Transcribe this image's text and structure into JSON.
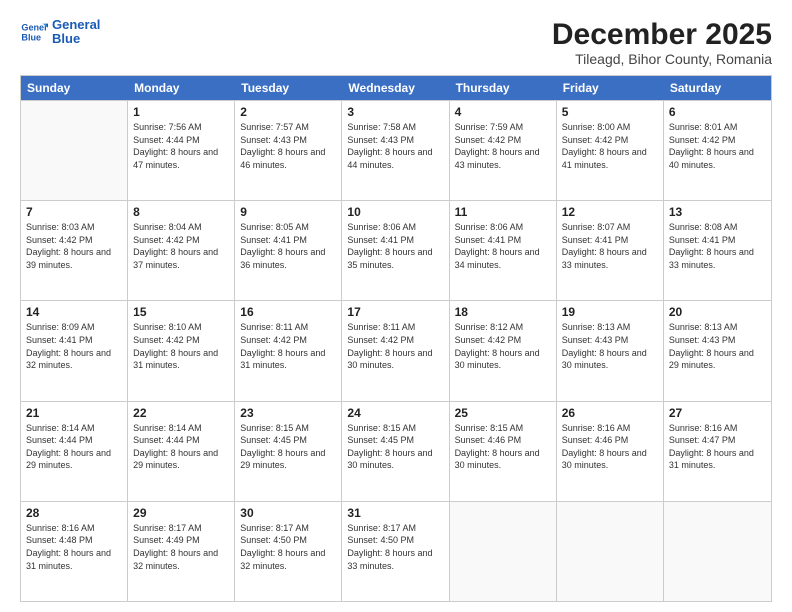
{
  "logo": {
    "line1": "General",
    "line2": "Blue"
  },
  "title": "December 2025",
  "subtitle": "Tileagd, Bihor County, Romania",
  "header_days": [
    "Sunday",
    "Monday",
    "Tuesday",
    "Wednesday",
    "Thursday",
    "Friday",
    "Saturday"
  ],
  "weeks": [
    [
      {
        "day": "",
        "empty": true
      },
      {
        "day": "1",
        "sunrise": "7:56 AM",
        "sunset": "4:44 PM",
        "daylight": "8 hours and 47 minutes."
      },
      {
        "day": "2",
        "sunrise": "7:57 AM",
        "sunset": "4:43 PM",
        "daylight": "8 hours and 46 minutes."
      },
      {
        "day": "3",
        "sunrise": "7:58 AM",
        "sunset": "4:43 PM",
        "daylight": "8 hours and 44 minutes."
      },
      {
        "day": "4",
        "sunrise": "7:59 AM",
        "sunset": "4:42 PM",
        "daylight": "8 hours and 43 minutes."
      },
      {
        "day": "5",
        "sunrise": "8:00 AM",
        "sunset": "4:42 PM",
        "daylight": "8 hours and 41 minutes."
      },
      {
        "day": "6",
        "sunrise": "8:01 AM",
        "sunset": "4:42 PM",
        "daylight": "8 hours and 40 minutes."
      }
    ],
    [
      {
        "day": "7",
        "sunrise": "8:03 AM",
        "sunset": "4:42 PM",
        "daylight": "8 hours and 39 minutes."
      },
      {
        "day": "8",
        "sunrise": "8:04 AM",
        "sunset": "4:42 PM",
        "daylight": "8 hours and 37 minutes."
      },
      {
        "day": "9",
        "sunrise": "8:05 AM",
        "sunset": "4:41 PM",
        "daylight": "8 hours and 36 minutes."
      },
      {
        "day": "10",
        "sunrise": "8:06 AM",
        "sunset": "4:41 PM",
        "daylight": "8 hours and 35 minutes."
      },
      {
        "day": "11",
        "sunrise": "8:06 AM",
        "sunset": "4:41 PM",
        "daylight": "8 hours and 34 minutes."
      },
      {
        "day": "12",
        "sunrise": "8:07 AM",
        "sunset": "4:41 PM",
        "daylight": "8 hours and 33 minutes."
      },
      {
        "day": "13",
        "sunrise": "8:08 AM",
        "sunset": "4:41 PM",
        "daylight": "8 hours and 33 minutes."
      }
    ],
    [
      {
        "day": "14",
        "sunrise": "8:09 AM",
        "sunset": "4:41 PM",
        "daylight": "8 hours and 32 minutes."
      },
      {
        "day": "15",
        "sunrise": "8:10 AM",
        "sunset": "4:42 PM",
        "daylight": "8 hours and 31 minutes."
      },
      {
        "day": "16",
        "sunrise": "8:11 AM",
        "sunset": "4:42 PM",
        "daylight": "8 hours and 31 minutes."
      },
      {
        "day": "17",
        "sunrise": "8:11 AM",
        "sunset": "4:42 PM",
        "daylight": "8 hours and 30 minutes."
      },
      {
        "day": "18",
        "sunrise": "8:12 AM",
        "sunset": "4:42 PM",
        "daylight": "8 hours and 30 minutes."
      },
      {
        "day": "19",
        "sunrise": "8:13 AM",
        "sunset": "4:43 PM",
        "daylight": "8 hours and 30 minutes."
      },
      {
        "day": "20",
        "sunrise": "8:13 AM",
        "sunset": "4:43 PM",
        "daylight": "8 hours and 29 minutes."
      }
    ],
    [
      {
        "day": "21",
        "sunrise": "8:14 AM",
        "sunset": "4:44 PM",
        "daylight": "8 hours and 29 minutes."
      },
      {
        "day": "22",
        "sunrise": "8:14 AM",
        "sunset": "4:44 PM",
        "daylight": "8 hours and 29 minutes."
      },
      {
        "day": "23",
        "sunrise": "8:15 AM",
        "sunset": "4:45 PM",
        "daylight": "8 hours and 29 minutes."
      },
      {
        "day": "24",
        "sunrise": "8:15 AM",
        "sunset": "4:45 PM",
        "daylight": "8 hours and 30 minutes."
      },
      {
        "day": "25",
        "sunrise": "8:15 AM",
        "sunset": "4:46 PM",
        "daylight": "8 hours and 30 minutes."
      },
      {
        "day": "26",
        "sunrise": "8:16 AM",
        "sunset": "4:46 PM",
        "daylight": "8 hours and 30 minutes."
      },
      {
        "day": "27",
        "sunrise": "8:16 AM",
        "sunset": "4:47 PM",
        "daylight": "8 hours and 31 minutes."
      }
    ],
    [
      {
        "day": "28",
        "sunrise": "8:16 AM",
        "sunset": "4:48 PM",
        "daylight": "8 hours and 31 minutes."
      },
      {
        "day": "29",
        "sunrise": "8:17 AM",
        "sunset": "4:49 PM",
        "daylight": "8 hours and 32 minutes."
      },
      {
        "day": "30",
        "sunrise": "8:17 AM",
        "sunset": "4:50 PM",
        "daylight": "8 hours and 32 minutes."
      },
      {
        "day": "31",
        "sunrise": "8:17 AM",
        "sunset": "4:50 PM",
        "daylight": "8 hours and 33 minutes."
      },
      {
        "day": "",
        "empty": true
      },
      {
        "day": "",
        "empty": true
      },
      {
        "day": "",
        "empty": true
      }
    ]
  ]
}
